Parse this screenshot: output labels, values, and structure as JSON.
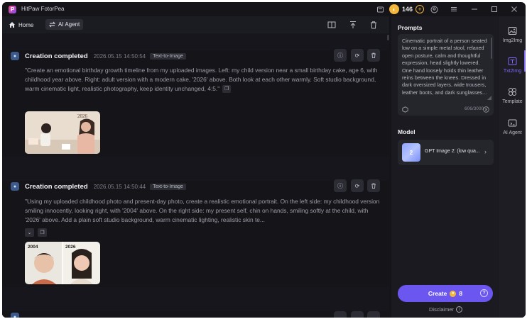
{
  "app": {
    "title": "HitPaw FotorPea",
    "logo_letter": "P"
  },
  "titlebar": {
    "credits": "146",
    "coin_symbol": "◐",
    "plus_symbol": "+"
  },
  "nav": {
    "home": "Home",
    "agent": "AI Agent"
  },
  "cards": [
    {
      "status": "Creation completed",
      "timestamp": "2026.05.15  14:50:54",
      "tag": "Text-to-Image",
      "prompt": "\"Create an emotional birthday growth timeline from my uploaded images. Left: my child version near a small birthday cake, age 6, with childhood year above. Right: adult version with a modern cake, '2026' above. Both look at each other warmly. Soft studio background, warm cinematic light, realistic photography, keep identity unchanged, 4:5.\"",
      "image_label": "2026"
    },
    {
      "status": "Creation completed",
      "timestamp": "2026.05.15  14:50:44",
      "tag": "Text-to-Image",
      "prompt": "\"Using my uploaded childhood photo and present-day photo, create a realistic emotional portrait. On the left side: my childhood version smiling innocently, looking right, with '2004' above. On the right side: my present self, chin on hands, smiling softly at the child, with '2026' above. Add a plain soft studio background, warm cinematic lighting, realistic skin te...",
      "image_labels": [
        "2004",
        "2026"
      ]
    }
  ],
  "panel": {
    "prompts_title": "Prompts",
    "prompt_text": "Cinematic portrait of a person seated low on a simple metal stool, relaxed open posture, calm and thoughtful expression, head slightly lowered. One hand loosely holds thin leather reins between the knees. Dressed in dark oversized layers, wide trousers, leather boots, and dark sunglasses...",
    "count": "606/3000",
    "model_title": "Model",
    "model_name": "GPT Image 2: (low qua...",
    "model_badge": "2",
    "create_label": "Create",
    "create_cost": "8",
    "disclaimer": "Disclaimer"
  },
  "rail": [
    {
      "label": "Img2Img",
      "icon": "image-icon"
    },
    {
      "label": "Txt2Img",
      "icon": "text-image-icon",
      "active": true
    },
    {
      "label": "Template",
      "icon": "template-icon"
    },
    {
      "label": "AI Agent",
      "icon": "ai-agent-icon"
    }
  ],
  "colors": {
    "accent": "#6b57f0",
    "background": "#141419",
    "coin": "#f4b73b"
  }
}
